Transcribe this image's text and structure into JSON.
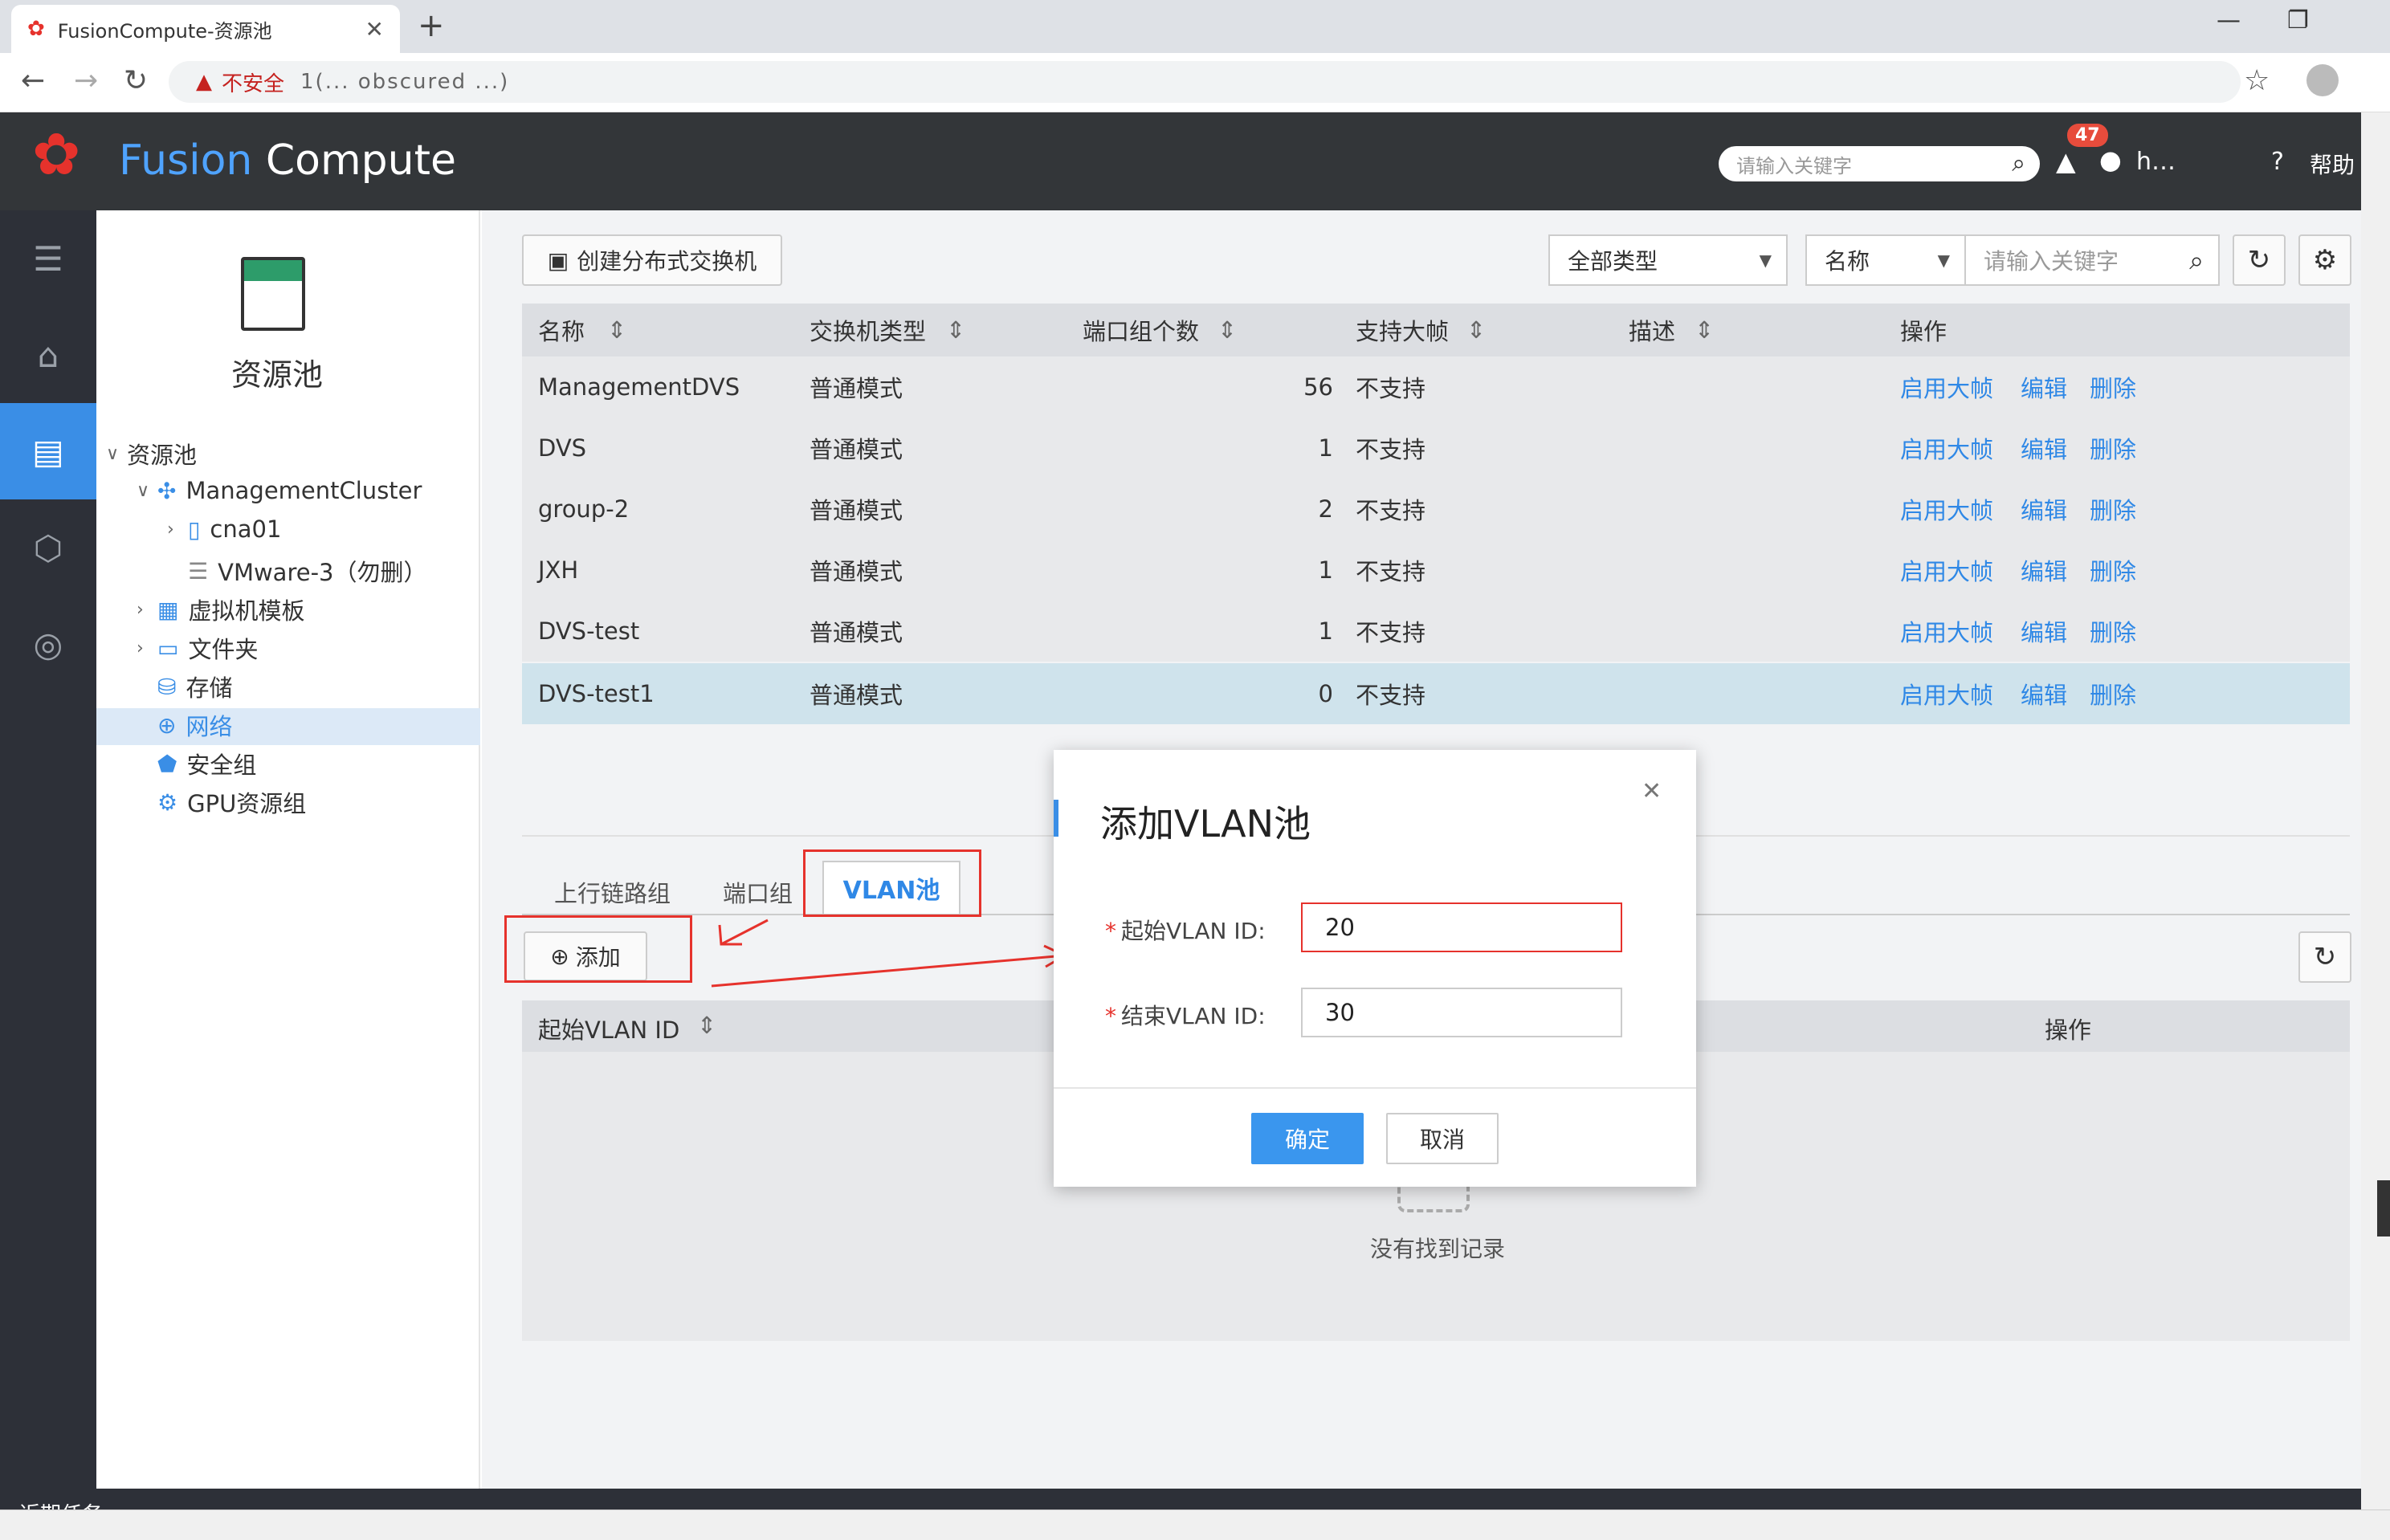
{
  "browser": {
    "tab_title": "FusionCompute-资源池",
    "new_tab": "+",
    "security_label": "不安全",
    "url_obscured": "1(... obscured ...)"
  },
  "header": {
    "brand_fusion": "Fusion",
    "brand_compute": "Compute",
    "search_placeholder": "请输入关键字",
    "alarm_count": "47",
    "username": "h…",
    "help": "帮助"
  },
  "sidebar": {
    "title": "资源池",
    "tree": [
      {
        "label": "资源池"
      },
      {
        "label": "ManagementCluster"
      },
      {
        "label": "cna01"
      },
      {
        "label": "VMware-3（勿删）"
      },
      {
        "label": "虚拟机模板"
      },
      {
        "label": "文件夹"
      },
      {
        "label": "存储"
      },
      {
        "label": "网络"
      },
      {
        "label": "安全组"
      },
      {
        "label": "GPU资源组"
      }
    ]
  },
  "toolbar": {
    "create_dvs": "创建分布式交换机",
    "type_filter": "全部类型",
    "field_filter": "名称",
    "search_placeholder": "请输入关键字"
  },
  "table": {
    "headers": [
      "名称",
      "交换机类型",
      "端口组个数",
      "支持大帧",
      "描述",
      "操作"
    ],
    "rows": [
      {
        "name": "ManagementDVS",
        "type": "普通模式",
        "ports": "56",
        "jumbo": "不支持"
      },
      {
        "name": "DVS",
        "type": "普通模式",
        "ports": "1",
        "jumbo": "不支持"
      },
      {
        "name": "group-2",
        "type": "普通模式",
        "ports": "2",
        "jumbo": "不支持"
      },
      {
        "name": "JXH",
        "type": "普通模式",
        "ports": "1",
        "jumbo": "不支持"
      },
      {
        "name": "DVS-test",
        "type": "普通模式",
        "ports": "1",
        "jumbo": "不支持"
      },
      {
        "name": "DVS-test1",
        "type": "普通模式",
        "ports": "0",
        "jumbo": "不支持"
      }
    ],
    "actions": [
      "启用大帧",
      "编辑",
      "删除"
    ]
  },
  "subtabs": {
    "uplink": "上行链路组",
    "portgroup": "端口组",
    "vlanpool": "VLAN池"
  },
  "lower": {
    "add_button": "添加",
    "col_start": "起始VLAN ID",
    "col_action": "操作",
    "empty": "没有找到记录"
  },
  "modal": {
    "title": "添加VLAN池",
    "start_label": "起始VLAN ID:",
    "start_value": "20",
    "end_label": "结束VLAN ID:",
    "end_value": "30",
    "ok": "确定",
    "cancel": "取消"
  },
  "footer": {
    "tasks": "近期任务"
  },
  "colors": {
    "accent": "#3a8ee6",
    "link": "#2f88e6",
    "danger": "#e6322c",
    "header_bg": "#333639"
  }
}
